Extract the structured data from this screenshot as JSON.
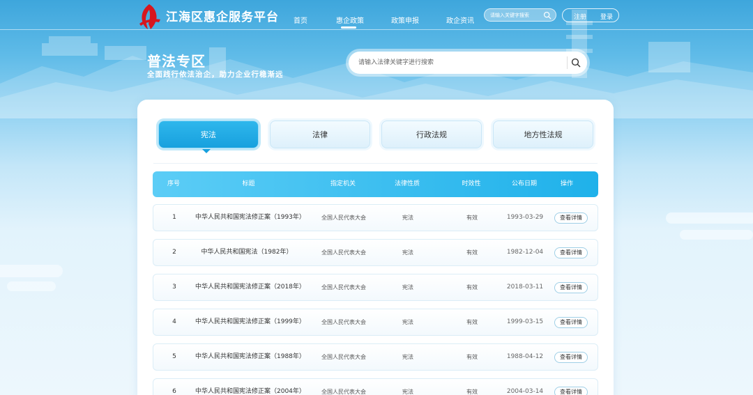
{
  "header": {
    "site_title": "江海区惠企服务平台",
    "nav": [
      {
        "label": "首页"
      },
      {
        "label": "惠企政策"
      },
      {
        "label": "政策申报"
      },
      {
        "label": "政企资讯"
      }
    ],
    "active_nav": "惠企政策",
    "top_search_placeholder": "请输入关键字搜索",
    "register_label": "注册",
    "login_label": "登录"
  },
  "hero": {
    "title": "普法专区",
    "subtitle": "全面践行依法治企，助力企业行稳渐远",
    "search_placeholder": "请输入法律关键字进行搜索"
  },
  "tabs": [
    {
      "label": "宪法",
      "active": true
    },
    {
      "label": "法律",
      "active": false
    },
    {
      "label": "行政法规",
      "active": false
    },
    {
      "label": "地方性法规",
      "active": false
    }
  ],
  "table": {
    "columns": [
      "序号",
      "标题",
      "指定机关",
      "法律性质",
      "时效性",
      "公布日期",
      "操作"
    ],
    "rows": [
      {
        "no": "1",
        "title": "中华人民共和国宪法修正案（1993年）",
        "authority": "全国人民代表大会",
        "nature": "宪法",
        "validity": "有效",
        "date": "1993-03-29",
        "action": "查看详情"
      },
      {
        "no": "2",
        "title": "中华人民共和国宪法（1982年）",
        "authority": "全国人民代表大会",
        "nature": "宪法",
        "validity": "有效",
        "date": "1982-12-04",
        "action": "查看详情"
      },
      {
        "no": "3",
        "title": "中华人民共和国宪法修正案（2018年）",
        "authority": "全国人民代表大会",
        "nature": "宪法",
        "validity": "有效",
        "date": "2018-03-11",
        "action": "查看详情"
      },
      {
        "no": "4",
        "title": "中华人民共和国宪法修正案（1999年）",
        "authority": "全国人民代表大会",
        "nature": "宪法",
        "validity": "有效",
        "date": "1999-03-15",
        "action": "查看详情"
      },
      {
        "no": "5",
        "title": "中华人民共和国宪法修正案（1988年）",
        "authority": "全国人民代表大会",
        "nature": "宪法",
        "validity": "有效",
        "date": "1988-04-12",
        "action": "查看详情"
      },
      {
        "no": "6",
        "title": "中华人民共和国宪法修正案（2004年）",
        "authority": "全国人民代表大会",
        "nature": "宪法",
        "validity": "有效",
        "date": "2004-03-14",
        "action": "查看详情"
      }
    ]
  },
  "colors": {
    "accent": "#1fb1ea",
    "logo_red": "#d7161e",
    "header_bg": "#3ea6dc"
  }
}
